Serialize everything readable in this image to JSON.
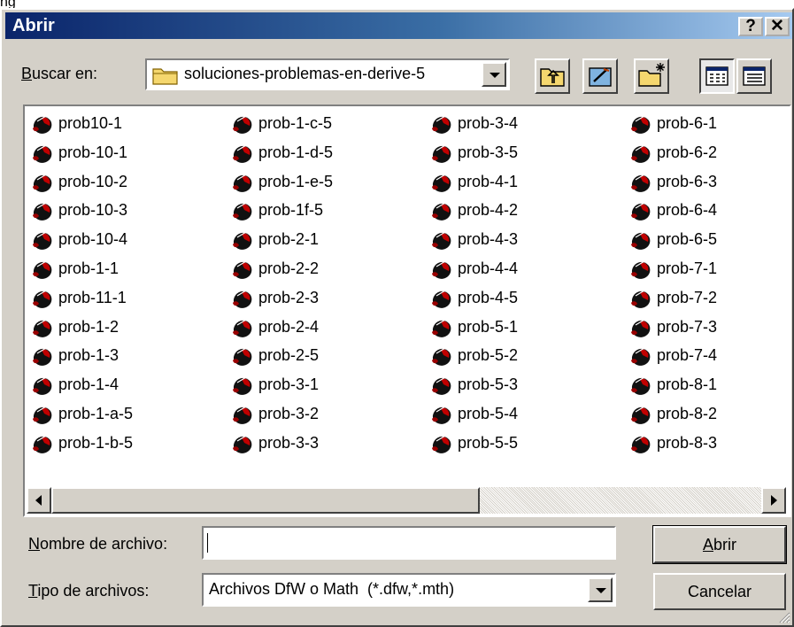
{
  "outer_label": "ng",
  "window": {
    "title": "Abrir",
    "help_button": "?",
    "close_button": "✕"
  },
  "lookin": {
    "label_prefix": "",
    "label_hotkey": "B",
    "label_rest": "uscar en:",
    "folder": "soluciones-problemas-en-derive-5"
  },
  "toolbar": {
    "icons": [
      "up-folder-icon",
      "desktop-icon",
      "new-folder-icon",
      "list-view-icon",
      "details-view-icon"
    ]
  },
  "files": {
    "col1": [
      "prob10-1",
      "prob-10-1",
      "prob-10-2",
      "prob-10-3",
      "prob-10-4",
      "prob-1-1",
      "prob-11-1",
      "prob-1-2",
      "prob-1-3",
      "prob-1-4",
      "prob-1-a-5",
      "prob-1-b-5"
    ],
    "col2": [
      "prob-1-c-5",
      "prob-1-d-5",
      "prob-1-e-5",
      "prob-1f-5",
      "prob-2-1",
      "prob-2-2",
      "prob-2-3",
      "prob-2-4",
      "prob-2-5",
      "prob-3-1",
      "prob-3-2",
      "prob-3-3"
    ],
    "col3": [
      "prob-3-4",
      "prob-3-5",
      "prob-4-1",
      "prob-4-2",
      "prob-4-3",
      "prob-4-4",
      "prob-4-5",
      "prob-5-1",
      "prob-5-2",
      "prob-5-3",
      "prob-5-4",
      "prob-5-5"
    ],
    "col4": [
      "prob-6-1",
      "prob-6-2",
      "prob-6-3",
      "prob-6-4",
      "prob-6-5",
      "prob-7-1",
      "prob-7-2",
      "prob-7-3",
      "prob-7-4",
      "prob-8-1",
      "prob-8-2",
      "prob-8-3"
    ]
  },
  "filename": {
    "label_hotkey": "N",
    "label_rest": "ombre de archivo:",
    "value": ""
  },
  "filetype": {
    "label_hotkey": "T",
    "label_rest": "ipo de archivos:",
    "value": "Archivos DfW o Math  (*.dfw,*.mth)"
  },
  "buttons": {
    "open_hotkey": "A",
    "open_rest": "brir",
    "cancel": "Cancelar"
  }
}
